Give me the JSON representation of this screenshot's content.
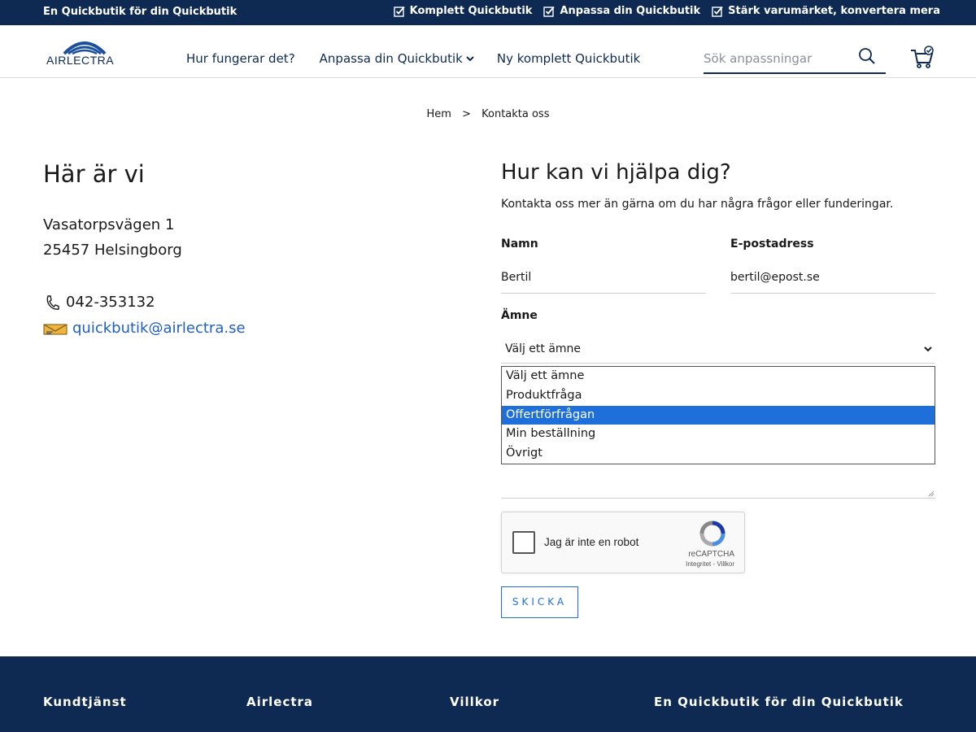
{
  "topbar": {
    "tagline": "En Quickbutik för din Quickbutik",
    "usps": [
      "Komplett Quickbutik",
      "Anpassa din Quickbutik",
      "Stärk varumärket, konvertera mera"
    ]
  },
  "header": {
    "logo_text": "AIRLECTRA",
    "nav": [
      "Hur fungerar det?",
      "Anpassa din Quickbutik",
      "Ny komplett Quickbutik"
    ],
    "search_placeholder": "Sök anpassningar"
  },
  "breadcrumb": {
    "home": "Hem",
    "separator": ">",
    "current": "Kontakta oss"
  },
  "contact": {
    "title": "Här är vi",
    "street": "Vasatorpsvägen 1",
    "city": "25457 Helsingborg",
    "phone": "042-353132",
    "email": "quickbutik@airlectra.se"
  },
  "form": {
    "title": "Hur kan vi hjälpa dig?",
    "intro": "Kontakta oss mer än gärna om du har några frågor eller funderingar.",
    "name_label": "Namn",
    "name_value": "Bertil",
    "email_label": "E-postadress",
    "email_value": "bertil@epost.se",
    "subject_label": "Ämne",
    "subject_value": "Välj ett ämne",
    "options": [
      "Välj ett ämne",
      "Produktfråga",
      "Offertförfrågan",
      "Min beställning",
      "Övrigt"
    ],
    "highlighted_option": "Offertförfrågan",
    "recaptcha": {
      "label": "Jag är inte en robot",
      "brand": "reCAPTCHA",
      "terms": "Integritet - Villkor"
    },
    "submit_label": "SKICKA"
  },
  "footer": {
    "columns": [
      "Kundtjänst",
      "Airlectra",
      "Villkor",
      "En Quickbutik för din Quickbutik"
    ]
  },
  "colors": {
    "navy": "#0e2a52",
    "accent_blue": "#1e6fd9",
    "link_blue": "#1f5fbf"
  }
}
